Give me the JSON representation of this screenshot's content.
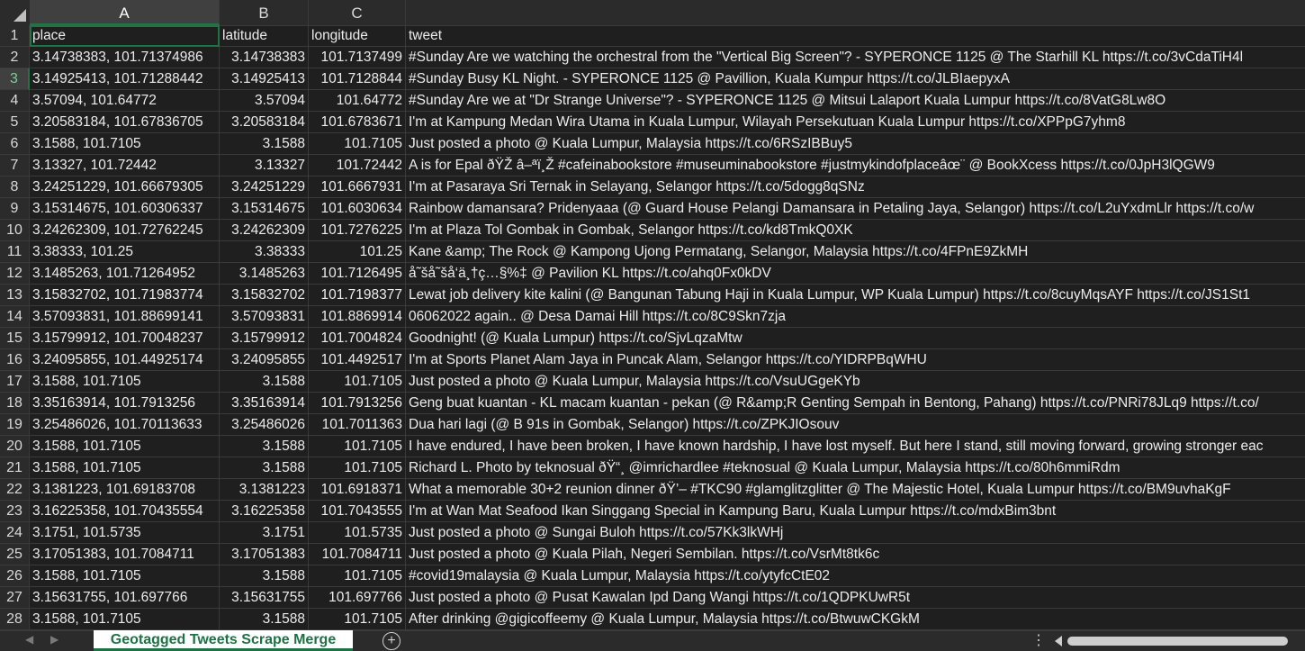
{
  "columns": [
    "A",
    "B",
    "C"
  ],
  "headers": {
    "place": "place",
    "latitude": "latitude",
    "longitude": "longitude",
    "tweet": "tweet"
  },
  "rows": [
    {
      "n": "2",
      "place": "3.14738383, 101.71374986",
      "lat": "3.14738383",
      "lon": "101.7137499",
      "tweet": "#Sunday  Are we watching the orchestral from the \"Vertical Big Screen\"?  - SYPERONCE 1125 @ The Starhill KL  https://t.co/3vCdaTiH4l"
    },
    {
      "n": "3",
      "place": "3.14925413, 101.71288442",
      "lat": "3.14925413",
      "lon": "101.7128844",
      "tweet": "#Sunday  Busy KL Night.  - SYPERONCE 1125 @ Pavillion, Kuala Kumpur  https://t.co/JLBIaepyxA"
    },
    {
      "n": "4",
      "place": "3.57094, 101.64772",
      "lat": "3.57094",
      "lon": "101.64772",
      "tweet": "#Sunday  Are we at \"Dr Strange Universe\"?  - SYPERONCE 1125 @ Mitsui Lalaport Kuala Lumpur  https://t.co/8VatG8Lw8O"
    },
    {
      "n": "5",
      "place": "3.20583184, 101.67836705",
      "lat": "3.20583184",
      "lon": "101.6783671",
      "tweet": "I'm at Kampung Medan Wira Utama in Kuala Lumpur, Wilayah Persekutuan Kuala Lumpur  https://t.co/XPPpG7yhm8"
    },
    {
      "n": "6",
      "place": "3.1588, 101.7105",
      "lat": "3.1588",
      "lon": "101.7105",
      "tweet": "Just posted a photo @ Kuala Lumpur, Malaysia  https://t.co/6RSzIBBuy5"
    },
    {
      "n": "7",
      "place": "3.13327, 101.72442",
      "lat": "3.13327",
      "lon": "101.72442",
      "tweet": "A is for Epal ðŸŽ  â–ªï¸Ž #cafeinabookstore #museuminabookstore #justmykindofplaceâœ¨ @ BookXcess  https://t.co/0JpH3lQGW9"
    },
    {
      "n": "8",
      "place": "3.24251229, 101.66679305",
      "lat": "3.24251229",
      "lon": "101.6667931",
      "tweet": "I'm at Pasaraya Sri Ternak in Selayang, Selangor  https://t.co/5dogg8qSNz"
    },
    {
      "n": "9",
      "place": "3.15314675, 101.60306337",
      "lat": "3.15314675",
      "lon": "101.6030634",
      "tweet": "Rainbow damansara? Pridenyaaa (@ Guard House Pelangi Damansara in Petaling Jaya, Selangor)  https://t.co/L2uYxdmLlr  https://t.co/w"
    },
    {
      "n": "10",
      "place": "3.24262309, 101.72762245",
      "lat": "3.24262309",
      "lon": "101.7276225",
      "tweet": "I'm at Plaza Tol Gombak in Gombak, Selangor  https://t.co/kd8TmkQ0XK"
    },
    {
      "n": "11",
      "place": "3.38333, 101.25",
      "lat": "3.38333",
      "lon": "101.25",
      "tweet": "Kane &amp; The Rock @ Kampong Ujong Permatang, Selangor, Malaysia  https://t.co/4FPnE9ZkMH"
    },
    {
      "n": "12",
      "place": "3.1485263, 101.71264952",
      "lat": "3.1485263",
      "lon": "101.7126495",
      "tweet": "å˜šå˜šå‘ä¸†ç…§%‡ @ Pavilion KL  https://t.co/ahq0Fx0kDV"
    },
    {
      "n": "13",
      "place": "3.15832702, 101.71983774",
      "lat": "3.15832702",
      "lon": "101.7198377",
      "tweet": "Lewat job delivery kite kalini (@ Bangunan Tabung Haji in Kuala Lumpur, WP Kuala Lumpur)  https://t.co/8cuyMqsAYF  https://t.co/JS1St1"
    },
    {
      "n": "14",
      "place": "3.57093831, 101.88699141",
      "lat": "3.57093831",
      "lon": "101.8869914",
      "tweet": "06062022 again.. @ Desa Damai Hill  https://t.co/8C9Skn7zja"
    },
    {
      "n": "15",
      "place": "3.15799912, 101.70048237",
      "lat": "3.15799912",
      "lon": "101.7004824",
      "tweet": "Goodnight! (@ Kuala Lumpur)  https://t.co/SjvLqzaMtw"
    },
    {
      "n": "16",
      "place": "3.24095855, 101.44925174",
      "lat": "3.24095855",
      "lon": "101.4492517",
      "tweet": "I'm at Sports Planet Alam Jaya in Puncak Alam, Selangor  https://t.co/YIDRPBqWHU"
    },
    {
      "n": "17",
      "place": "3.1588, 101.7105",
      "lat": "3.1588",
      "lon": "101.7105",
      "tweet": "Just posted a photo @ Kuala Lumpur, Malaysia  https://t.co/VsuUGgeKYb"
    },
    {
      "n": "18",
      "place": "3.35163914, 101.7913256",
      "lat": "3.35163914",
      "lon": "101.7913256",
      "tweet": "Geng buat kuantan - KL macam kuantan - pekan (@ R&amp;R Genting Sempah in Bentong, Pahang)  https://t.co/PNRi78JLq9  https://t.co/"
    },
    {
      "n": "19",
      "place": "3.25486026, 101.70113633",
      "lat": "3.25486026",
      "lon": "101.7011363",
      "tweet": "Dua hari lagi (@ B 91s in Gombak, Selangor)  https://t.co/ZPKJIOsouv"
    },
    {
      "n": "20",
      "place": "3.1588, 101.7105",
      "lat": "3.1588",
      "lon": "101.7105",
      "tweet": "I have endured, I have been broken, I have known hardship, I have lost myself. But here I stand, still moving forward, growing stronger eac"
    },
    {
      "n": "21",
      "place": "3.1588, 101.7105",
      "lat": "3.1588",
      "lon": "101.7105",
      "tweet": "Richard L. Photo by teknosual ðŸ“¸ @imrichardlee #teknosual @ Kuala Lumpur, Malaysia  https://t.co/80h6mmiRdm"
    },
    {
      "n": "22",
      "place": "3.1381223, 101.69183708",
      "lat": "3.1381223",
      "lon": "101.6918371",
      "tweet": "What a memorable 30+2 reunion dinner ðŸ’– #TKC90  #glamglitzglitter @ The Majestic Hotel, Kuala Lumpur  https://t.co/BM9uvhaKgF"
    },
    {
      "n": "23",
      "place": "3.16225358, 101.70435554",
      "lat": "3.16225358",
      "lon": "101.7043555",
      "tweet": "I'm at Wan Mat Seafood Ikan Singgang Special in Kampung Baru, Kuala Lumpur  https://t.co/mdxBim3bnt"
    },
    {
      "n": "24",
      "place": "3.1751, 101.5735",
      "lat": "3.1751",
      "lon": "101.5735",
      "tweet": "Just posted a photo @ Sungai Buloh  https://t.co/57Kk3lkWHj"
    },
    {
      "n": "25",
      "place": "3.17051383, 101.7084711",
      "lat": "3.17051383",
      "lon": "101.7084711",
      "tweet": "Just posted a photo @ Kuala Pilah, Negeri Sembilan.  https://t.co/VsrMt8tk6c"
    },
    {
      "n": "26",
      "place": "3.1588, 101.7105",
      "lat": "3.1588",
      "lon": "101.7105",
      "tweet": "#covid19malaysia @ Kuala Lumpur, Malaysia  https://t.co/ytyfcCtE02"
    },
    {
      "n": "27",
      "place": "3.15631755, 101.697766",
      "lat": "3.15631755",
      "lon": "101.697766",
      "tweet": "Just posted a photo @ Pusat Kawalan Ipd Dang Wangi  https://t.co/1QDPKUwR5t"
    },
    {
      "n": "28",
      "place": "3.1588, 101.7105",
      "lat": "3.1588",
      "lon": "101.7105",
      "tweet": "After drinking @gigicoffeemy @ Kuala Lumpur, Malaysia  https://t.co/BtwuwCKGkM"
    }
  ],
  "sheet_tab": "Geotagged Tweets Scrape Merge",
  "icons": {
    "add_sheet": "plus-circle-icon",
    "options": "vertical-dots-icon",
    "scroll_left": "scroll-left-arrow-icon"
  },
  "colors": {
    "accent": "#217346",
    "tab_text": "#1e7145",
    "background": "#1f1f1f"
  }
}
